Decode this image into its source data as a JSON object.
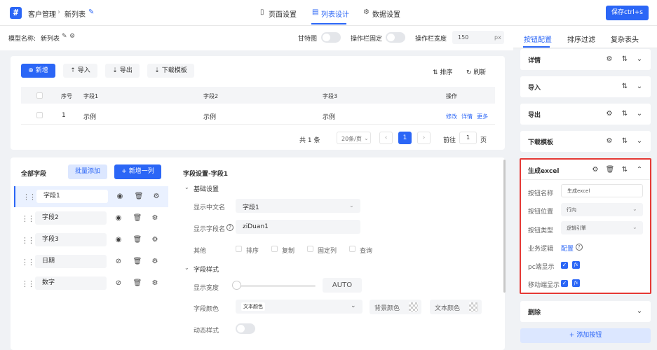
{
  "header": {
    "breadcrumb": [
      "客户管理",
      "新列表"
    ],
    "nav": [
      {
        "label": "页面设置",
        "icon": "bookmark-icon"
      },
      {
        "label": "列表设计",
        "icon": "document-icon",
        "active": true
      },
      {
        "label": "数据设置",
        "icon": "gear-icon"
      }
    ],
    "save_label": "保存ctrl+s"
  },
  "model": {
    "name_label": "模型名称:",
    "name_value": "新列表",
    "gantt_label": "甘特图",
    "fixed_label": "操作栏固定",
    "width_label": "操作栏宽度",
    "width_value": "150",
    "width_unit": "px"
  },
  "toolbar": {
    "add": "新增",
    "import": "导入",
    "export": "导出",
    "download": "下载模板",
    "sort": "排序",
    "refresh": "刷新"
  },
  "table": {
    "headers": [
      "序号",
      "字段1",
      "字段2",
      "字段3",
      "操作"
    ],
    "rows": [
      {
        "index": "1",
        "c1": "示例",
        "c2": "示例",
        "c3": "示例",
        "actions": [
          "修改",
          "详情",
          "更多"
        ]
      }
    ]
  },
  "pager": {
    "total": "共 1 条",
    "page_size": "20条/页",
    "current": "1",
    "goto_label": "前往",
    "goto_value": "1",
    "page_unit": "页"
  },
  "fields": {
    "title": "全部字段",
    "batch_add": "批量添加",
    "add_col": "新增一列",
    "items": [
      {
        "name": "字段1",
        "visible": true
      },
      {
        "name": "字段2",
        "visible": true
      },
      {
        "name": "字段3",
        "visible": true
      },
      {
        "name": "日期",
        "visible": false
      },
      {
        "name": "数字",
        "visible": false
      }
    ]
  },
  "settings": {
    "title": "字段设置-字段1",
    "basic": "基础设置",
    "cn_name_label": "显示中文名",
    "cn_name_value": "字段1",
    "field_name_label": "显示字段名",
    "field_name_value": "ziDuan1",
    "other_label": "其他",
    "other_options": [
      "排序",
      "复制",
      "固定列",
      "查询"
    ],
    "style": "字段样式",
    "width_label": "显示宽度",
    "width_value": "AUTO",
    "color_label": "字段颜色",
    "color_value": "文本颜色",
    "bg_color_label": "背景颜色",
    "text_color_label": "文本颜色",
    "dynamic_label": "动态样式"
  },
  "right_panel": {
    "tabs": [
      "按钮配置",
      "排序过滤",
      "复杂表头"
    ],
    "buttons": [
      "详情",
      "导入",
      "导出",
      "下载模板"
    ],
    "expanded": {
      "title": "生成excel",
      "name_label": "按钮名称",
      "name_value": "生成excel",
      "position_label": "按钮位置",
      "position_value": "行内",
      "type_label": "按钮类型",
      "type_value": "逻辑引擎",
      "logic_label": "业务逻辑",
      "logic_link": "配置",
      "pc_label": "pc端显示",
      "mobile_label": "移动端显示"
    },
    "delete": "删除",
    "add_button": "添加按钮",
    "accent": "#2b66f6",
    "highlight": "#e53935"
  }
}
